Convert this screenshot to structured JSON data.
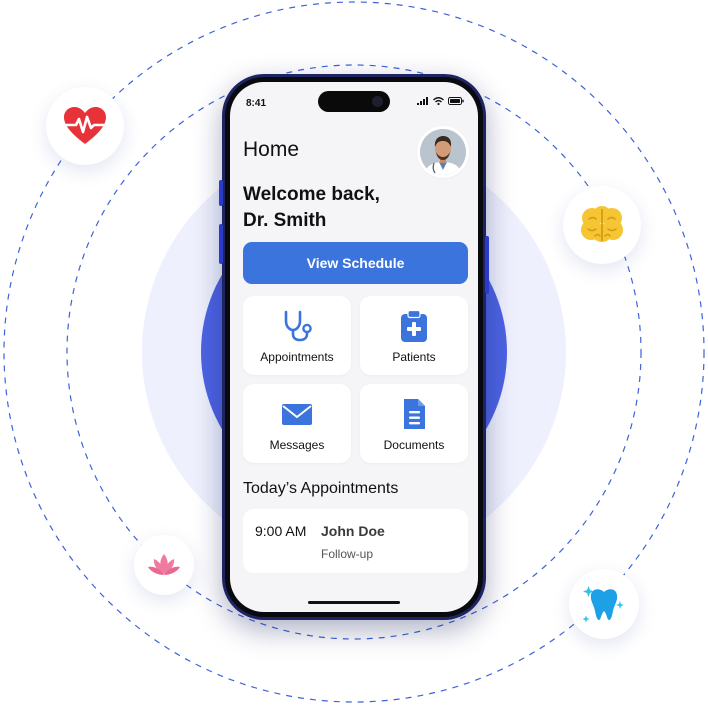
{
  "status_bar": {
    "time": "8:41",
    "icons": [
      "signal-icon",
      "wifi-icon",
      "battery-icon"
    ]
  },
  "header": {
    "title": "Home",
    "avatar": "doctor-avatar"
  },
  "welcome": {
    "line1": "Welcome back,",
    "line2": "Dr. Smith"
  },
  "primary_action": {
    "label": "View Schedule"
  },
  "quick_actions": [
    {
      "label": "Appointments",
      "icon": "stethoscope-icon"
    },
    {
      "label": "Patients",
      "icon": "medical-clipboard-icon"
    },
    {
      "label": "Messages",
      "icon": "envelope-icon"
    },
    {
      "label": "Documents",
      "icon": "document-icon"
    }
  ],
  "appointments_section": {
    "title": "Today’s Appointments",
    "items": [
      {
        "time": "9:00 AM",
        "patient": "John Doe",
        "type": "Follow-up"
      }
    ]
  },
  "floating_badges": [
    "heart-rate-icon",
    "brain-icon",
    "lotus-icon",
    "tooth-icon"
  ],
  "colors": {
    "accent": "#3B74DD",
    "screen_bg": "#F5F5F7",
    "phone_frame": "#1E2462",
    "orbit_line": "#3E63D8",
    "halo_outer": "#EEF0FD",
    "halo_inner": "#4D63E3"
  }
}
